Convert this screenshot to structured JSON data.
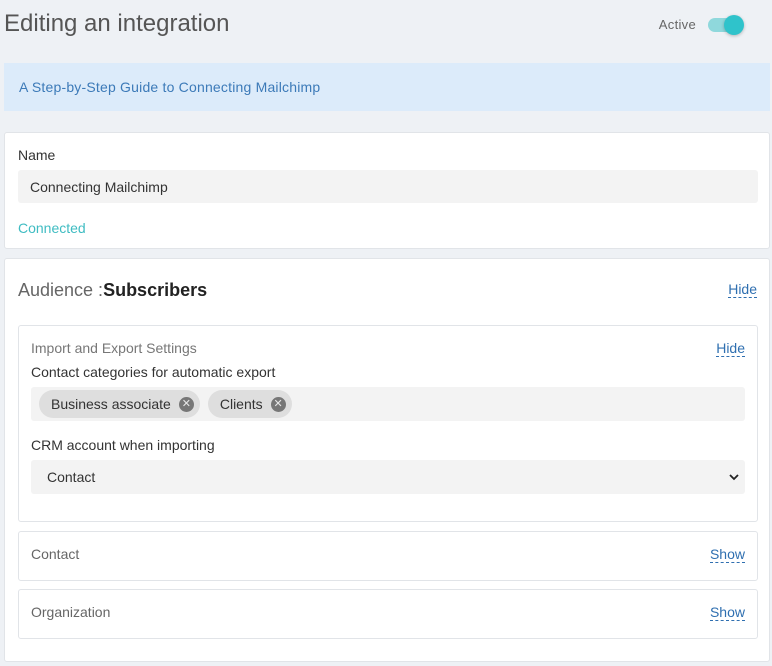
{
  "header": {
    "title": "Editing an integration",
    "active_label": "Active",
    "active_on": true
  },
  "guide": {
    "link_text": "A Step-by-Step Guide to Connecting Mailchimp"
  },
  "name_section": {
    "label": "Name",
    "value": "Connecting Mailchimp",
    "status": "Connected"
  },
  "audience": {
    "prefix": "Audience :",
    "name": "Subscribers",
    "toggle_label": "Hide",
    "import_export": {
      "title": "Import and Export Settings",
      "toggle_label": "Hide",
      "categories_label": "Contact categories for automatic export",
      "categories": [
        "Business associate",
        "Clients"
      ],
      "crm_label": "CRM account when importing",
      "crm_value": "Contact"
    },
    "contact": {
      "title": "Contact",
      "toggle_label": "Show"
    },
    "organization": {
      "title": "Organization",
      "toggle_label": "Show"
    }
  },
  "colors": {
    "accent": "#2fc3cb",
    "link": "#2f6fb0",
    "banner_bg": "#dcebfa",
    "connected": "#3fbcc2"
  },
  "icons": {
    "chip_remove": "close-circle-icon",
    "select_arrow": "chevron-down-icon"
  }
}
